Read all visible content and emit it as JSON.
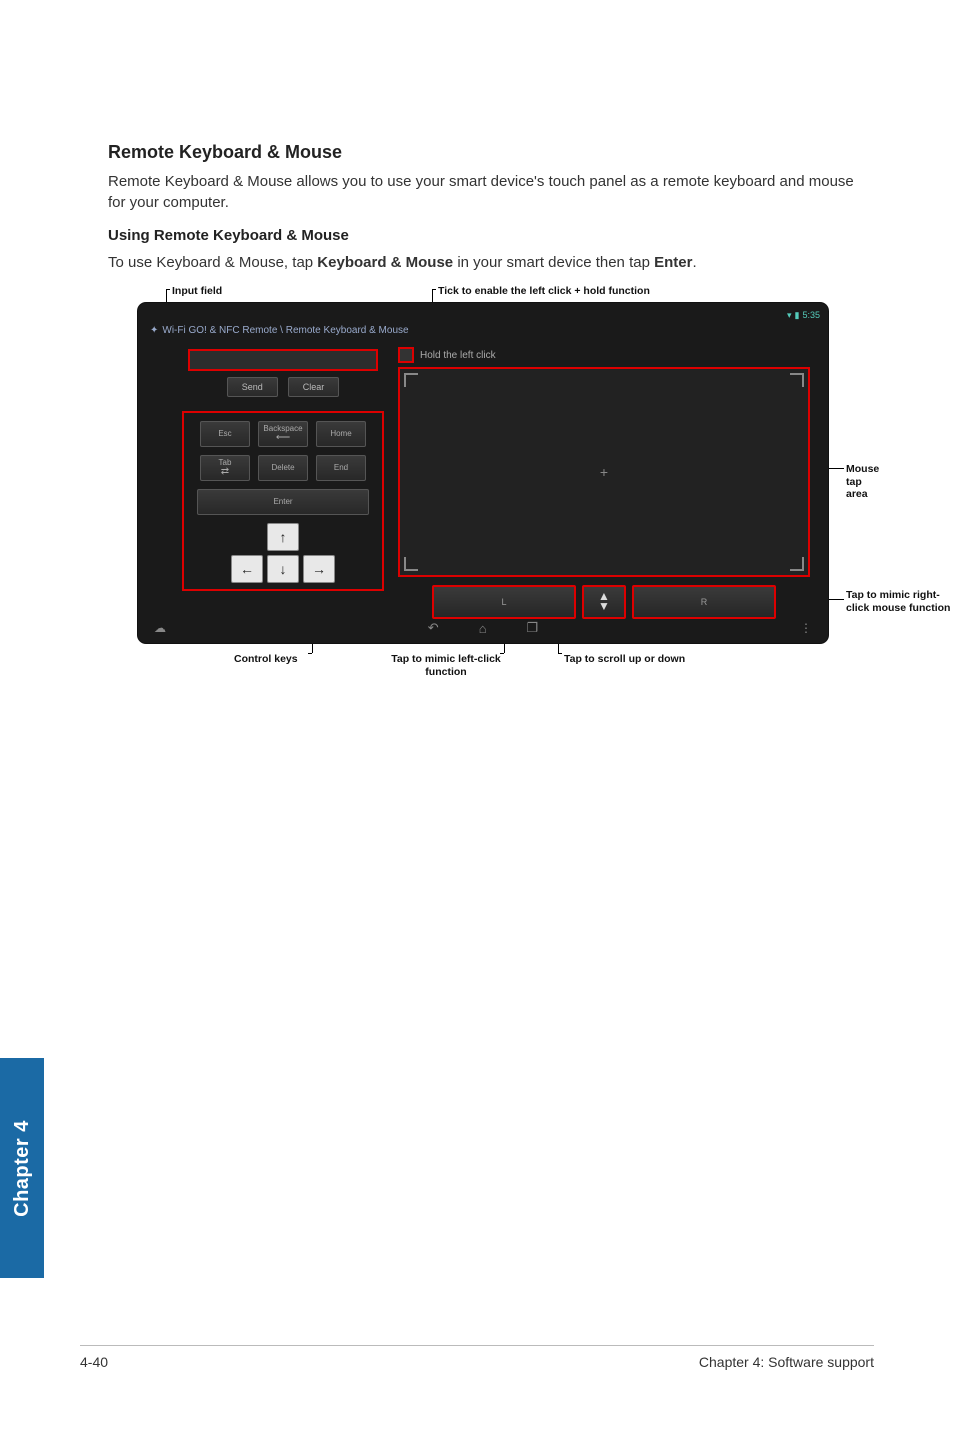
{
  "heading": "Remote Keyboard & Mouse",
  "intro": "Remote Keyboard & Mouse allows you to use your smart device's touch panel as a remote keyboard and mouse for your computer.",
  "sub_heading": "Using Remote Keyboard & Mouse",
  "instruction_pre": "To use Keyboard & Mouse, tap ",
  "instruction_bold1": "Keyboard & Mouse",
  "instruction_mid": " in your smart device then tap ",
  "instruction_bold2": "Enter",
  "instruction_end": ".",
  "callouts": {
    "input_field": "Input field",
    "tick": "Tick to enable the left click + hold function",
    "mouse_tap": "Mouse tap area",
    "right_click": "Tap to mimic right-click mouse function",
    "control_keys": "Control keys",
    "left_click": "Tap to mimic left-click function",
    "scroll": "Tap to scroll up or down"
  },
  "device": {
    "status_time": "5:35",
    "title": "Wi-Fi GO! & NFC Remote \\ Remote Keyboard & Mouse",
    "send": "Send",
    "clear": "Clear",
    "esc": "Esc",
    "backspace": "Backspace",
    "home": "Home",
    "tab": "Tab",
    "delete": "Delete",
    "end": "End",
    "enter": "Enter",
    "hold": "Hold the left click",
    "L": "L",
    "R": "R",
    "arrows": {
      "up": "↑",
      "down": "↓",
      "left": "←",
      "right": "→"
    },
    "scroll_up": "▲",
    "scroll_down": "▼"
  },
  "sidebar": "Chapter 4",
  "footer_left": "4-40",
  "footer_right": "Chapter 4: Software support"
}
